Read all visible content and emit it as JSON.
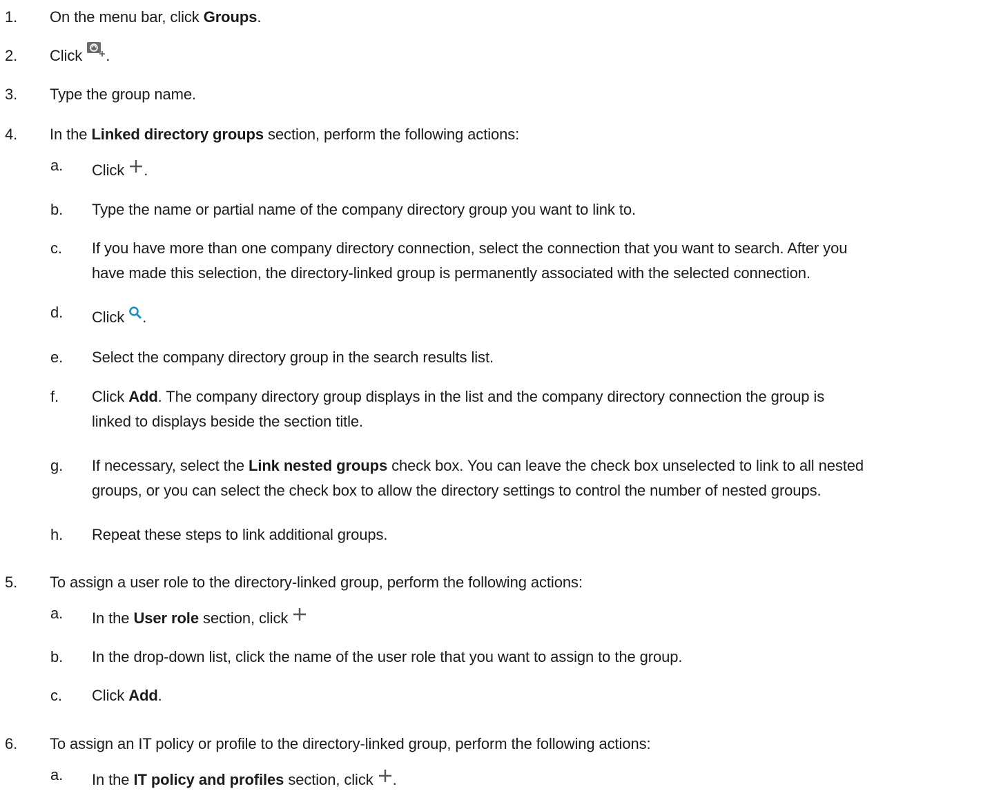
{
  "steps": [
    {
      "num": "1.",
      "pre": "On the menu bar, click ",
      "bold": "Groups",
      "post": "."
    },
    {
      "num": "2.",
      "pre": "Click ",
      "post": "."
    },
    {
      "num": "3.",
      "text": "Type the group name."
    },
    {
      "num": "4.",
      "pre": "In the ",
      "bold": "Linked directory groups",
      "post": " section, perform the following actions:",
      "subs": [
        {
          "letter": "a.",
          "pre": "Click ",
          "post": "."
        },
        {
          "letter": "b.",
          "text": "Type the name or partial name of the company directory group you want to link to."
        },
        {
          "letter": "c.",
          "line1": "If you have more than one company directory connection, select the connection that you want to search. After you",
          "line2": "have made this selection, the directory-linked group is permanently associated with the selected connection."
        },
        {
          "letter": "d.",
          "pre": "Click ",
          "post": "."
        },
        {
          "letter": "e.",
          "text": "Select the company directory group in the search results list."
        },
        {
          "letter": "f.",
          "pre": "Click ",
          "bold": "Add",
          "post": ". The company directory group displays in the list and the company directory connection the group is",
          "line2": "linked to displays beside the section title."
        },
        {
          "letter": "g.",
          "pre": "If necessary, select the ",
          "bold": "Link nested groups",
          "post": " check box. You can leave the check box unselected to link to all nested",
          "line2": "groups, or you can select the check box to allow the directory settings to control the number of nested groups."
        },
        {
          "letter": "h.",
          "text": "Repeat these steps to link additional groups."
        }
      ]
    },
    {
      "num": "5.",
      "text": "To assign a user role to the directory-linked group, perform the following actions:",
      "subs": [
        {
          "letter": "a.",
          "pre": "In the ",
          "bold": "User role",
          "post": " section, click "
        },
        {
          "letter": "b.",
          "text": "In the drop-down list, click the name of the user role that you want to assign to the group."
        },
        {
          "letter": "c.",
          "pre": "Click ",
          "bold": "Add",
          "post": "."
        }
      ]
    },
    {
      "num": "6.",
      "text": "To assign an IT policy or profile to the directory-linked group, perform the following actions:",
      "subs": [
        {
          "letter": "a.",
          "pre": "In the ",
          "bold": "IT policy and profiles",
          "post": " section, click ",
          "post2": "."
        }
      ]
    }
  ],
  "icons": {
    "add_group": "add-group-icon",
    "plus": "plus-icon",
    "search": "search-icon",
    "accent": "#1a8fbf",
    "icon_gray": "#555555"
  }
}
